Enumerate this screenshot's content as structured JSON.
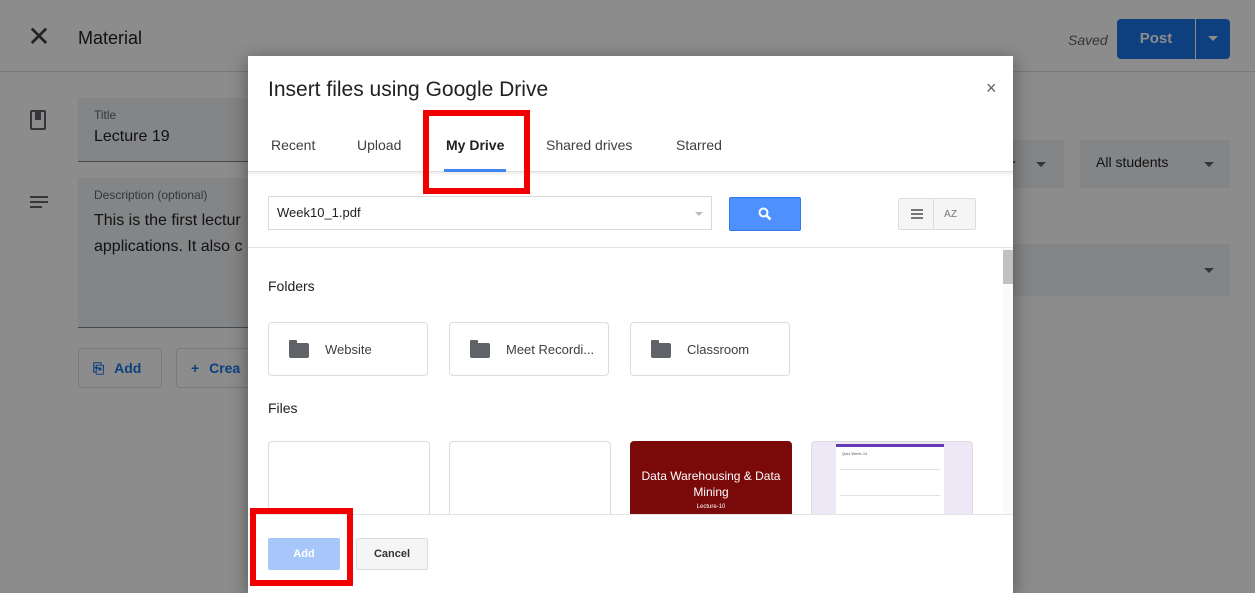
{
  "page": {
    "close_icon": "close-icon",
    "title": "Material",
    "status": "Saved",
    "post_label": "Post",
    "title_field": {
      "label": "Title",
      "value": "Lecture 19"
    },
    "description_field": {
      "label": "Description (optional)",
      "value_line1": "This is the first lectur",
      "value_line2": "applications. It also c"
    },
    "add_label": "Add",
    "create_label": "Crea",
    "audience_select": "All students"
  },
  "dialog": {
    "title": "Insert files using Google Drive",
    "close": "×",
    "tabs": [
      "Recent",
      "Upload",
      "My Drive",
      "Shared drives",
      "Starred"
    ],
    "active_tab": "My Drive",
    "search_value": "Week10_1.pdf",
    "sort_glyph": "A Z",
    "folders_label": "Folders",
    "folders": [
      "Website",
      "Meet Recordi...",
      "Classroom"
    ],
    "files_label": "Files",
    "file_thumbs": {
      "red_title": "Data Warehousing & Data Mining",
      "red_subtitle": "Lecture-10",
      "form_title": "Quiz Week-14"
    },
    "add_button": "Add",
    "cancel_button": "Cancel"
  },
  "colors": {
    "primary": "#1a73e8",
    "search_button": "#4d90fe",
    "annotation_red": "#f00000",
    "thumb_red": "#7a0a0a"
  }
}
